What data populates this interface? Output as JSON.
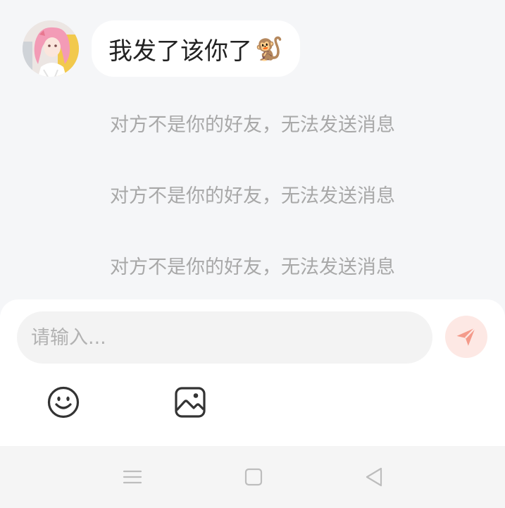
{
  "chat": {
    "message": {
      "text": "我发了该你了",
      "emoji": "🐒"
    },
    "notices": [
      "对方不是你的好友，无法发送消息",
      "对方不是你的好友，无法发送消息",
      "对方不是你的好友，无法发送消息"
    ]
  },
  "composer": {
    "placeholder": "请输入...",
    "send_icon": "paper-plane-icon",
    "tools": [
      "smiley-icon",
      "image-icon"
    ]
  },
  "navigation": {
    "buttons": [
      "menu-icon",
      "home-icon",
      "back-icon"
    ]
  },
  "colors": {
    "background": "#f5f6f8",
    "bubble": "#ffffff",
    "notice_text": "#a8a8a8",
    "send_button": "#fde8e4",
    "send_icon": "#f49a8a"
  }
}
